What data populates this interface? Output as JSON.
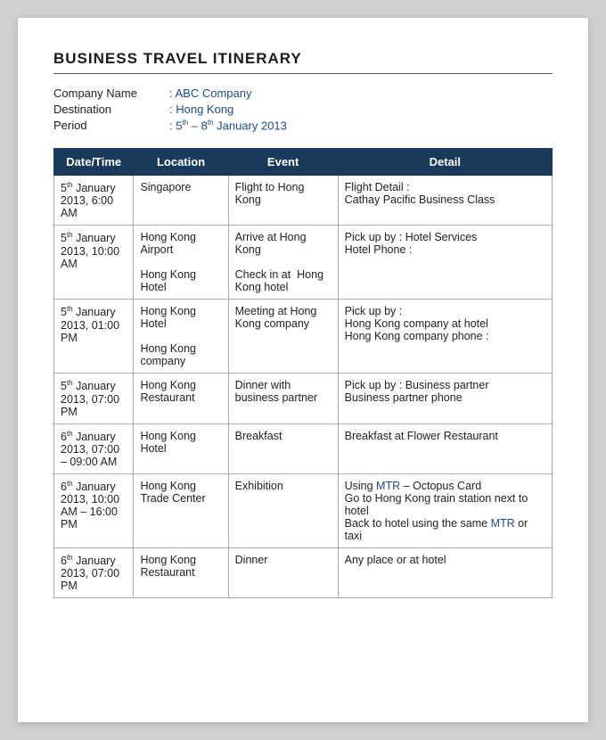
{
  "page": {
    "title": "BUSINESS TRAVEL ITINERARY",
    "meta": {
      "company_label": "Company Name",
      "company_value": ": ABC Company",
      "destination_label": "Destination",
      "destination_value": ": Hong Kong",
      "period_label": "Period",
      "period_value": ": 5th – 8th January 2013"
    },
    "table": {
      "headers": [
        "Date/Time",
        "Location",
        "Event",
        "Detail"
      ],
      "rows": [
        {
          "datetime": "5th January 2013, 6:00 AM",
          "location": "Singapore",
          "event": "Flight to Hong Kong",
          "detail": "Flight Detail :\nCathay Pacific Business Class"
        },
        {
          "datetime": "5th January 2013, 10:00 AM",
          "location": "Hong Kong Airport\nHong Kong Hotel",
          "event": "Arrive at Hong Kong\nCheck in at  Hong Kong hotel",
          "detail": "Pick up by : Hotel Services\nHotel Phone :"
        },
        {
          "datetime": "5th January 2013, 01:00 PM",
          "location": "Hong Kong Hotel\nHong Kong company",
          "event": "Meeting at Hong Kong company",
          "detail": "Pick up by :\nHong Kong company at hotel\nHong Kong company phone :"
        },
        {
          "datetime": "5th January 2013, 07:00 PM",
          "location": "Hong Kong Restaurant",
          "event": "Dinner with business partner",
          "detail": "Pick up by : Business partner\nBusiness partner phone"
        },
        {
          "datetime": "6th January 2013, 07:00 – 09:00 AM",
          "location": "Hong Kong Hotel",
          "event": "Breakfast",
          "detail": "Breakfast at Flower Restaurant"
        },
        {
          "datetime": "6th January 2013, 10:00 AM – 16:00 PM",
          "location": "Hong Kong Trade Center",
          "event": "Exhibition",
          "detail": "Using MTR – Octopus Card\nGo to Hong Kong train station next to hotel\nBack to hotel using the same MTR or taxi"
        },
        {
          "datetime": "6th January 2013, 07:00 PM",
          "location": "Hong Kong Restaurant",
          "event": "Dinner",
          "detail": "Any place or at hotel"
        }
      ]
    }
  }
}
